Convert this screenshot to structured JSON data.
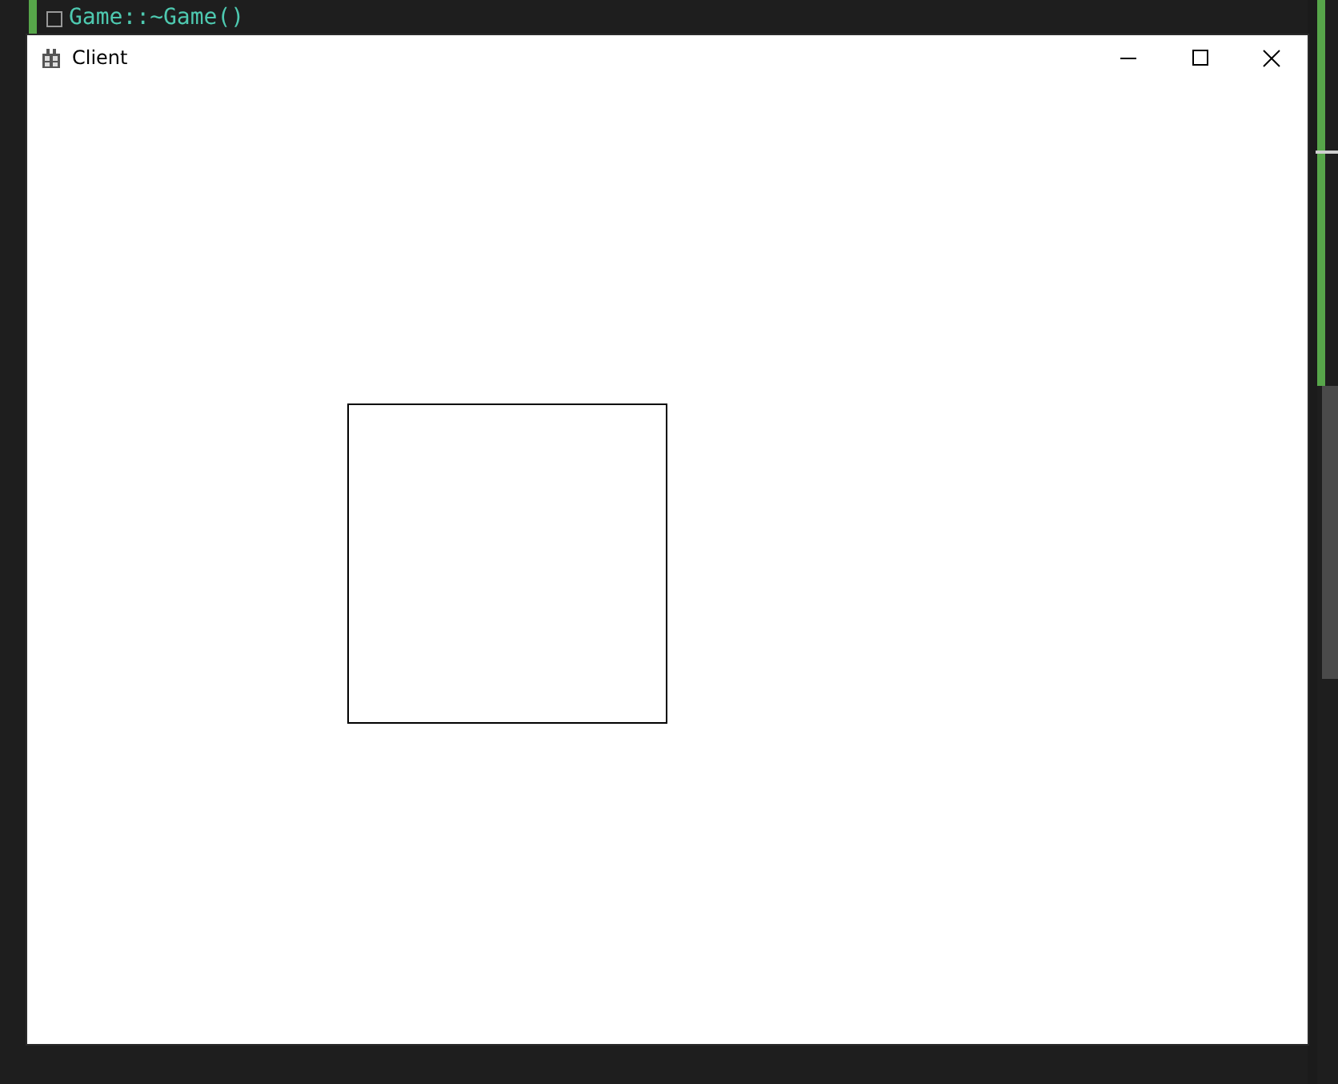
{
  "editor": {
    "code_line": "Game::~Game()"
  },
  "window": {
    "title": "Client"
  }
}
